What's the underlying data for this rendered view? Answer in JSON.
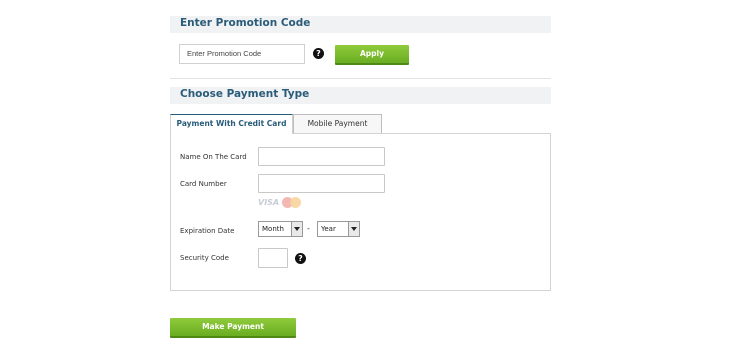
{
  "promotion": {
    "header": "Enter Promotion Code",
    "input_placeholder": "Enter Promotion Code",
    "help_icon": "?",
    "apply_label": "Apply"
  },
  "payment": {
    "header": "Choose Payment Type",
    "tabs": [
      {
        "label": "Payment With Credit Card",
        "active": true
      },
      {
        "label": "Mobile Payment",
        "active": false
      }
    ],
    "fields": {
      "name_label": "Name On The Card",
      "name_value": "",
      "card_label": "Card Number",
      "card_value": "",
      "card_logos": {
        "visa": "VISA",
        "mastercard": "mastercard-icon"
      },
      "expiration_label": "Expiration Date",
      "month_selected": "Month",
      "separator": "-",
      "year_selected": "Year",
      "security_label": "Security Code",
      "security_value": "",
      "security_help": "?"
    },
    "submit_label": "Make Payment"
  },
  "colors": {
    "accent": "#2a5c7a",
    "button_green": "#7bbd2e",
    "header_bg": "#f1f2f4"
  }
}
